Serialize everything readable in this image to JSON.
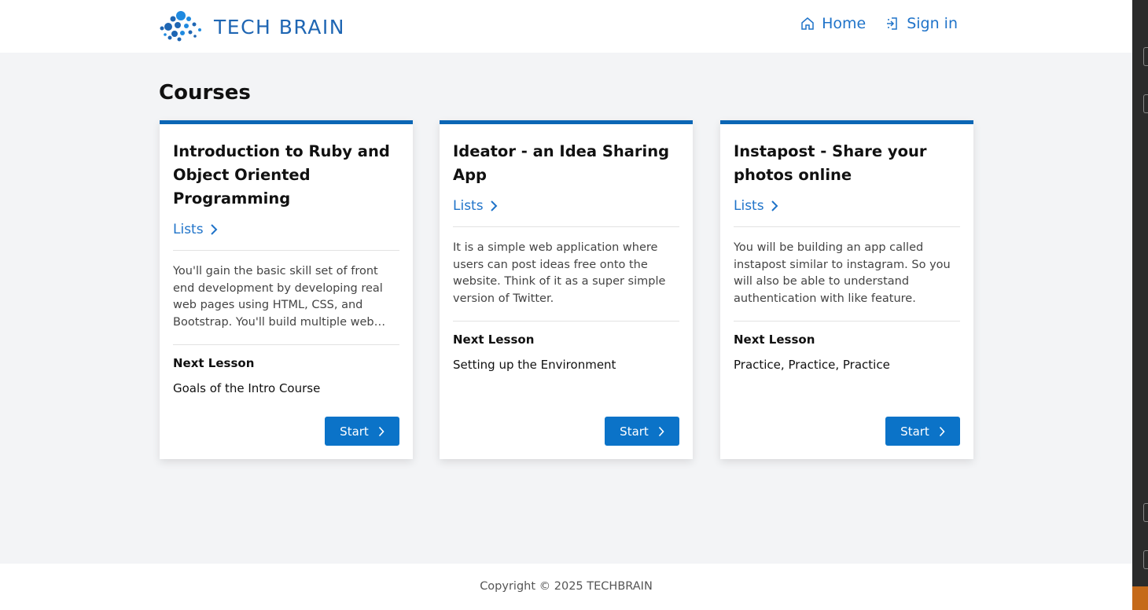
{
  "brand": {
    "name": "TECH BRAIN",
    "color": "#1f66b3"
  },
  "nav": {
    "home": {
      "label": "Home",
      "icon": "home-icon"
    },
    "signin": {
      "label": "Sign in",
      "icon": "sign-in-icon"
    }
  },
  "page": {
    "title": "Courses"
  },
  "courses": [
    {
      "title": "Introduction to Ruby and Object Oriented Programming",
      "lists_label": "Lists",
      "description": "You'll gain the basic skill set of front end development by developing real web pages using HTML, CSS, and Bootstrap. You'll build multiple web pages and learn how to make them responsive.",
      "next_lesson_label": "Next Lesson",
      "next_lesson": "Goals of the Intro Course",
      "start_label": "Start"
    },
    {
      "title": "Ideator - an Idea Sharing App",
      "lists_label": "Lists",
      "description": "It is a simple web application where users can post ideas free onto the website. Think of it as a super simple version of Twitter.",
      "next_lesson_label": "Next Lesson",
      "next_lesson": "Setting up the Environment",
      "start_label": "Start"
    },
    {
      "title": "Instapost - Share your photos online",
      "lists_label": "Lists",
      "description": "You will be building an app called instapost similar to instagram. So you will also be able to understand authentication with like feature.",
      "next_lesson_label": "Next Lesson",
      "next_lesson": "Practice, Practice, Practice",
      "start_label": "Start"
    }
  ],
  "footer": {
    "copyright": "Copyright © 2025 TECHBRAIN"
  },
  "colors": {
    "accent": "#0b73c8",
    "card_border": "#0b66b5",
    "background": "#f3f4f6"
  }
}
